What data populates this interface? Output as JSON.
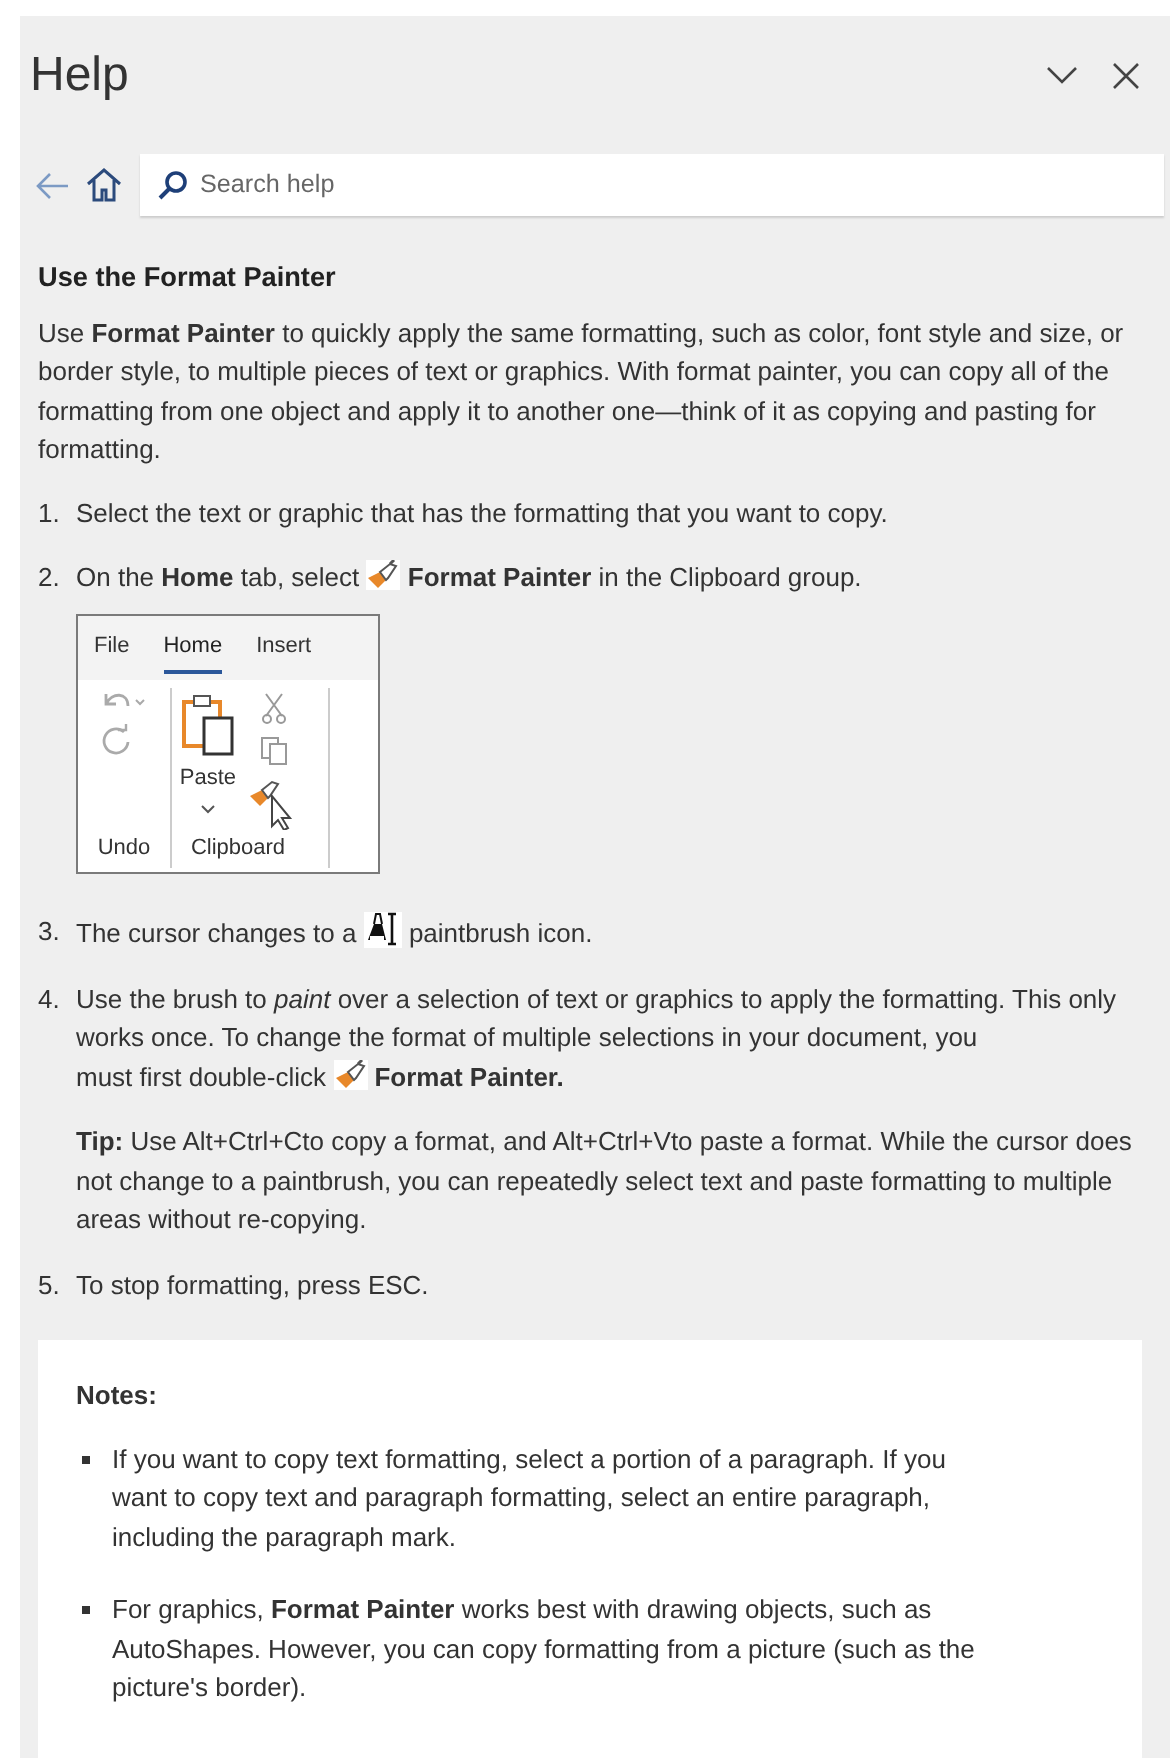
{
  "pane": {
    "title": "Help"
  },
  "search": {
    "placeholder": "Search help"
  },
  "article": {
    "heading": "Use the Format Painter",
    "intro": "Use **Format Painter** to quickly apply the same formatting, such as color, font style and size, or border style, to multiple pieces of text or graphics. With format painter, you can copy all of the formatting from one object and apply it to another one—think of it as copying and pasting for formatting.",
    "steps": [
      {
        "number": "1.",
        "lines": [
          [
            "Select the text or graphic that has the formatting that you want to copy."
          ]
        ]
      },
      {
        "number": "2.",
        "kind": "brush",
        "lines": [
          [
            "On the **Home** tab, select",
            "**Format Painter** in the Clipboard group."
          ]
        ],
        "figure": {
          "tabs": [
            {
              "label": "File",
              "selected": false
            },
            {
              "label": "Home",
              "selected": true
            },
            {
              "label": "Insert",
              "selected": false
            }
          ],
          "paste_label": "Paste",
          "groups": [
            "Undo",
            "Clipboard"
          ]
        }
      },
      {
        "number": "3.",
        "kind": "cursor",
        "lines": [
          [
            "The cursor changes to a",
            "paintbrush icon."
          ]
        ]
      },
      {
        "number": "4.",
        "kind": "brush",
        "lines": [
          [
            "Use the brush to *paint* over a selection of text or graphics to apply the formatting. This only works once. To change the format of multiple selections in your document, you"
          ],
          [
            "must first double-click",
            "**Format Painter.**"
          ]
        ],
        "tip": "**Tip:** Use Alt+Ctrl+Cto copy a format, and Alt+Ctrl+Vto paste a format. While the cursor does not change to a paintbrush, you can repeatedly select text and paste formatting to multiple areas without re-copying."
      },
      {
        "number": "5.",
        "lines": [
          [
            "To stop formatting, press ESC."
          ]
        ]
      }
    ],
    "notes": {
      "heading": "Notes:",
      "items": [
        "If you want to copy text formatting, select a portion of a paragraph. If you want to copy text and paragraph formatting, select an entire paragraph, including the paragraph mark.",
        "For graphics, **Format Painter** works best with drawing objects, such as AutoShapes. However, you can copy formatting from a picture (such as the picture's border)."
      ]
    }
  }
}
